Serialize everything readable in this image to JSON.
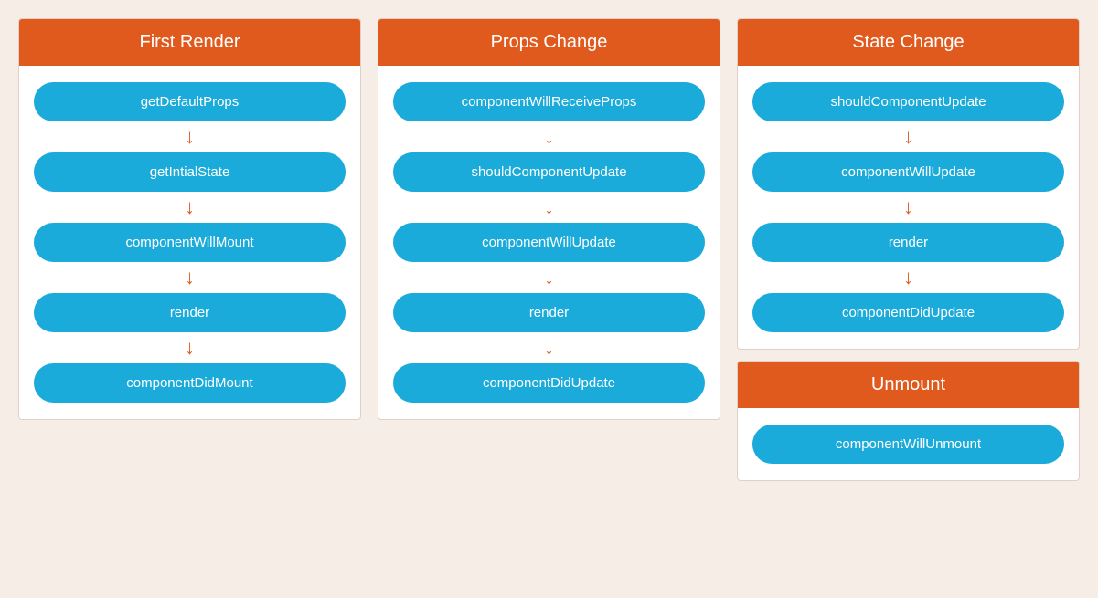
{
  "columns": [
    {
      "id": "first-render",
      "header": "First Render",
      "steps": [
        "getDefaultProps",
        "getIntialState",
        "componentWillMount",
        "render",
        "componentDidMount"
      ]
    },
    {
      "id": "props-change",
      "header": "Props Change",
      "steps": [
        "componentWillReceiveProps",
        "shouldComponentUpdate",
        "componentWillUpdate",
        "render",
        "componentDidUpdate"
      ]
    },
    {
      "id": "state-change",
      "header": "State Change",
      "steps": [
        "shouldComponentUpdate",
        "componentWillUpdate",
        "render",
        "componentDidUpdate"
      ]
    }
  ],
  "unmount": {
    "header": "Unmount",
    "steps": [
      "componentWillUnmount"
    ]
  },
  "colors": {
    "header_bg": "#e05a1e",
    "btn_bg": "#1aabdb",
    "arrow_color": "#e05a1e",
    "card_bg": "#ffffff",
    "page_bg": "#f5ede6"
  }
}
